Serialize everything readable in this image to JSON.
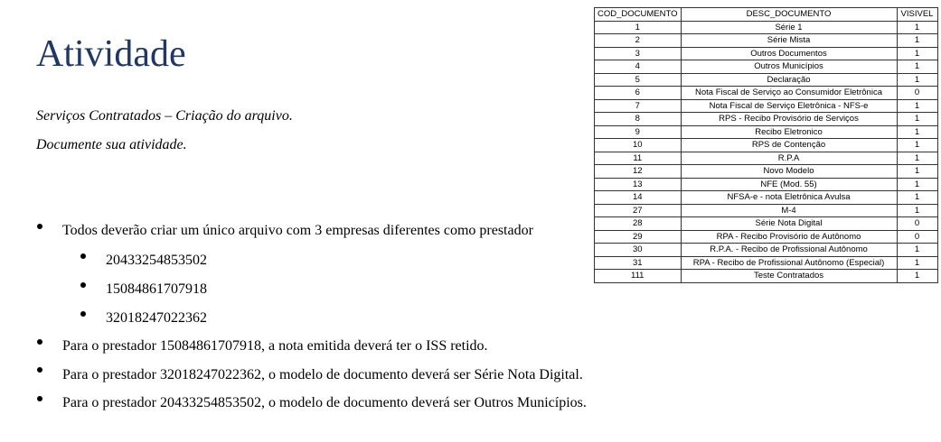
{
  "title": "Atividade",
  "subtitles": [
    "Serviços Contratados – Criação do arquivo.",
    "Documente sua atividade."
  ],
  "bullets": [
    {
      "text": "Todos deverão criar um único arquivo com 3 empresas diferentes como prestador",
      "level": 1
    },
    {
      "text": "20433254853502",
      "level": 2
    },
    {
      "text": "15084861707918",
      "level": 2
    },
    {
      "text": "32018247022362",
      "level": 2
    },
    {
      "text": "Para o prestador 15084861707918, a nota emitida deverá ter o ISS retido.",
      "level": 1
    },
    {
      "text": "Para o prestador 32018247022362, o modelo de documento deverá ser Série Nota Digital.",
      "level": 1
    },
    {
      "text": "Para o prestador 20433254853502, o modelo de documento deverá ser Outros Municípios.",
      "level": 1
    }
  ],
  "table": {
    "headers": [
      "COD_DOCUMENTO",
      "DESC_DOCUMENTO",
      "VISIVEL"
    ],
    "rows": [
      [
        "1",
        "Série 1",
        "1"
      ],
      [
        "2",
        "Série Mista",
        "1"
      ],
      [
        "3",
        "Outros Documentos",
        "1"
      ],
      [
        "4",
        "Outros Municípios",
        "1"
      ],
      [
        "5",
        "Declaração",
        "1"
      ],
      [
        "6",
        "Nota Fiscal de Serviço ao Consumidor Eletrônica",
        "0"
      ],
      [
        "7",
        "Nota Fiscal de Serviço Eletrônica - NFS-e",
        "1"
      ],
      [
        "8",
        "RPS - Recibo Provisório de Serviços",
        "1"
      ],
      [
        "9",
        "Recibo Eletronico",
        "1"
      ],
      [
        "10",
        "RPS de Contenção",
        "1"
      ],
      [
        "11",
        "R.P.A",
        "1"
      ],
      [
        "12",
        "Novo Modelo",
        "1"
      ],
      [
        "13",
        "NFE (Mod. 55)",
        "1"
      ],
      [
        "14",
        "NFSA-e - nota Eletrônica Avulsa",
        "1"
      ],
      [
        "27",
        "M-4",
        "1"
      ],
      [
        "28",
        "Série Nota Digital",
        "0"
      ],
      [
        "29",
        "RPA - Recibo Provisório de Autônomo",
        "0"
      ],
      [
        "30",
        "R.P.A. - Recibo de Profissional Autônomo",
        "1"
      ],
      [
        "31",
        "RPA - Recibo de Profissional Autônomo (Especial)",
        "1"
      ],
      [
        "111",
        "Teste Contratados",
        "1"
      ]
    ]
  },
  "colors": {
    "title": "#1f3864",
    "text": "#000000",
    "table_border": "#333333"
  }
}
